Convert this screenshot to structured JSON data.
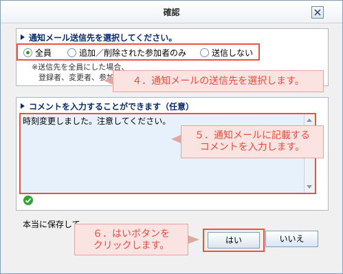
{
  "dialog": {
    "title": "確認",
    "close_icon": "close-icon"
  },
  "notify_section": {
    "heading": "通知メール送信先を選択してください。",
    "options": [
      {
        "label": "全員",
        "selected": true
      },
      {
        "label": "追加／削除された参加者のみ",
        "selected": false
      },
      {
        "label": "送信しない",
        "selected": false
      }
    ],
    "note_line1": "※送信先を全員にした場合、",
    "note_line2": "登録者、変更者、参加"
  },
  "comment_section": {
    "heading": "コメントを入力することができます（任意）",
    "value": "時刻変更しました。注意してください。"
  },
  "confirm": {
    "text": "本当に保存して",
    "yes_label": "はい",
    "no_label": "いいえ"
  },
  "callouts": {
    "step4": "４．通知メールの送信先を選択します。",
    "step5_line1": "５．通知メールに記載する",
    "step5_line2": "コメントを入力します。",
    "step6_line1": "６．はいボタンを",
    "step6_line2": "クリックします。"
  },
  "colors": {
    "highlight_border": "#e8533e",
    "callout_text": "#e84a3c",
    "callout_bg": "#fbe3e2"
  }
}
